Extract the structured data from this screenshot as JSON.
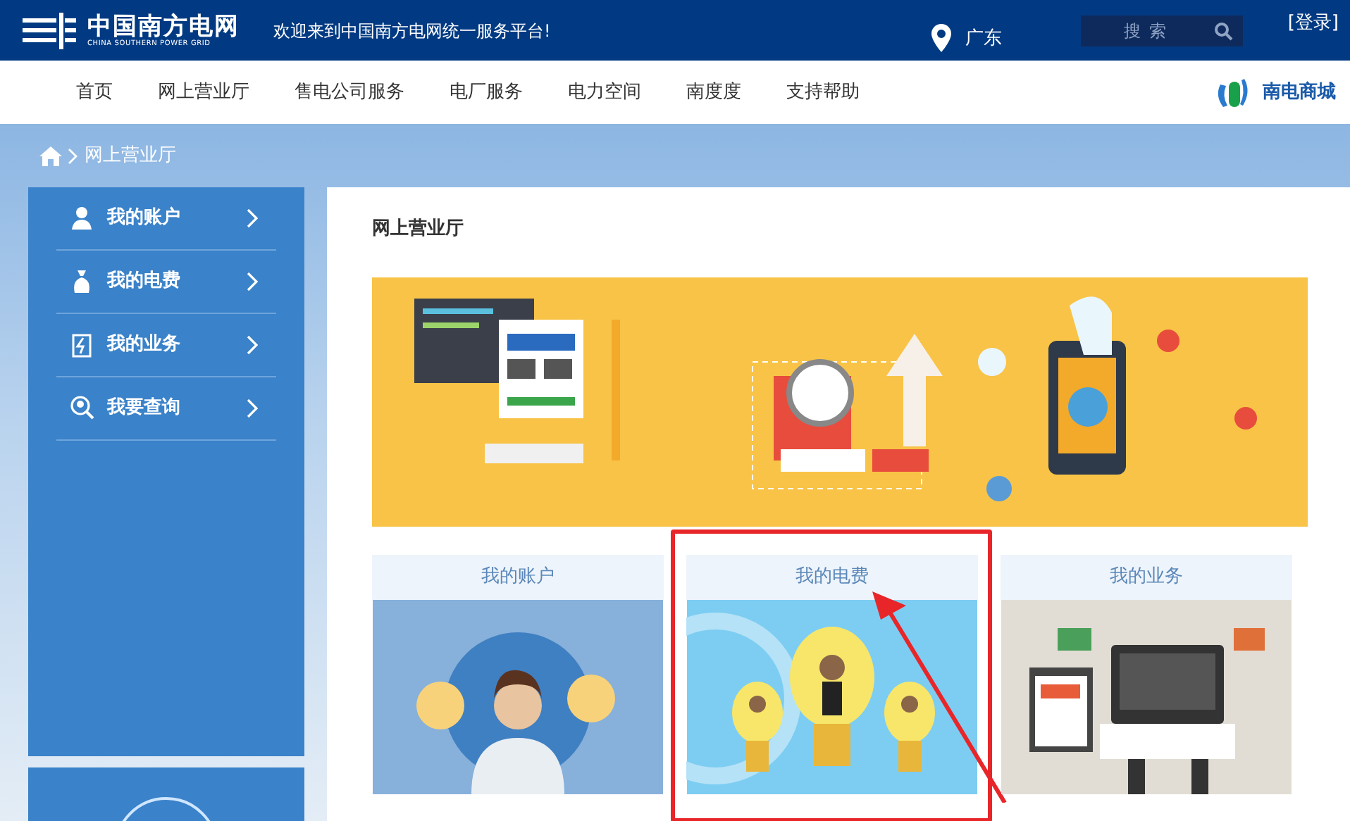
{
  "header": {
    "logo_title": "中国南方电网",
    "logo_subtitle": "CHINA SOUTHERN POWER GRID",
    "welcome": "欢迎来到中国南方电网统一服务平台!",
    "region": "广东",
    "search": {
      "placeholder": "搜索"
    },
    "login": "[登录]"
  },
  "nav": {
    "items": [
      {
        "label": "首页"
      },
      {
        "label": "网上营业厅"
      },
      {
        "label": "售电公司服务"
      },
      {
        "label": "电厂服务"
      },
      {
        "label": "电力空间"
      },
      {
        "label": "南度度"
      },
      {
        "label": "支持帮助"
      }
    ],
    "mall": "南电商城"
  },
  "breadcrumb": {
    "current": "网上营业厅"
  },
  "sidebar": {
    "items": [
      {
        "kind": "account",
        "label": "我的账户"
      },
      {
        "kind": "bill",
        "label": "我的电费"
      },
      {
        "kind": "business",
        "label": "我的业务"
      },
      {
        "kind": "query",
        "label": "我要查询"
      }
    ]
  },
  "main": {
    "title": "网上营业厅",
    "cards": [
      {
        "kind": "account",
        "title": "我的账户",
        "annotated": false
      },
      {
        "kind": "bill",
        "title": "我的电费",
        "annotated": true
      },
      {
        "kind": "business",
        "title": "我的业务",
        "annotated": false
      }
    ]
  }
}
